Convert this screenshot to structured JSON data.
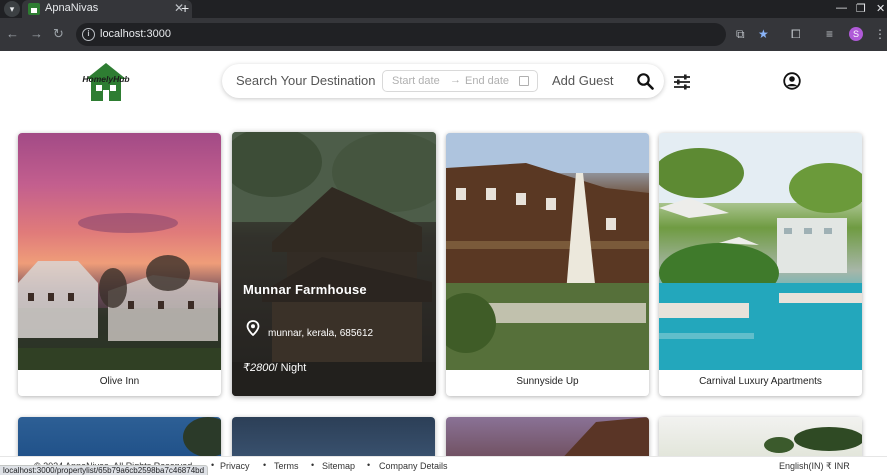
{
  "browser": {
    "tab_title": "ApnaNivas",
    "url": "localhost:3000",
    "profile_initial": "S",
    "status_url": "localhost:3000/propertylist/65b79a6cb2598ba7c46874bd"
  },
  "header": {
    "logo_text": "HomelyHub",
    "search_placeholder": "Search Your Destination",
    "date_start_placeholder": "Start date",
    "date_end_placeholder": "End date",
    "add_guest_label": "Add Guest"
  },
  "cards": [
    {
      "title": "Olive Inn"
    },
    {
      "title": "Munnar Farmhouse",
      "location": "munnar, kerala, 685612",
      "price": "₹2800",
      "price_unit": "/ Night"
    },
    {
      "title": "Sunnyside Up"
    },
    {
      "title": "Carnival Luxury Apartments"
    }
  ],
  "footer": {
    "copyright": "© 2024 ApnaNivas. All Rights Reserved",
    "links": [
      "Privacy",
      "Terms",
      "Sitemap",
      "Company Details"
    ],
    "language": "English(IN)",
    "currency": "₹ INR"
  },
  "colors": {
    "brand_green": "#2e7d32",
    "featured_overlay": "rgba(20,20,20,0.45)"
  }
}
